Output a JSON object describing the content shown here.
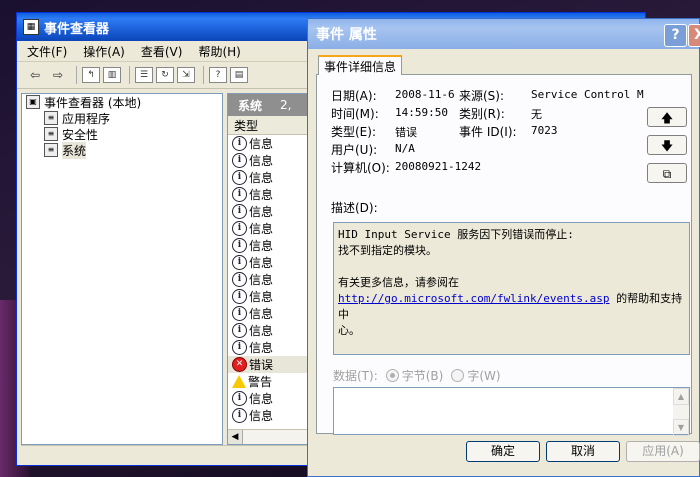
{
  "event_viewer": {
    "title": "事件查看器",
    "menu": [
      "文件(F)",
      "操作(A)",
      "查看(V)",
      "帮助(H)"
    ],
    "tree": [
      {
        "label": "事件查看器 (本地)",
        "icon": "computer-icon"
      },
      {
        "label": "应用程序",
        "icon": "log-icon"
      },
      {
        "label": "安全性",
        "icon": "log-icon"
      },
      {
        "label": "系统",
        "icon": "log-icon"
      }
    ],
    "list_header": "系统",
    "list_count": "2,",
    "column_type": "类型",
    "rows": [
      {
        "type": "信息",
        "level": "info"
      },
      {
        "type": "信息",
        "level": "info"
      },
      {
        "type": "信息",
        "level": "info"
      },
      {
        "type": "信息",
        "level": "info"
      },
      {
        "type": "信息",
        "level": "info"
      },
      {
        "type": "信息",
        "level": "info"
      },
      {
        "type": "信息",
        "level": "info"
      },
      {
        "type": "信息",
        "level": "info"
      },
      {
        "type": "信息",
        "level": "info"
      },
      {
        "type": "信息",
        "level": "info"
      },
      {
        "type": "信息",
        "level": "info"
      },
      {
        "type": "信息",
        "level": "info"
      },
      {
        "type": "信息",
        "level": "info"
      },
      {
        "type": "错误",
        "level": "error"
      },
      {
        "type": "警告",
        "level": "warning"
      },
      {
        "type": "信息",
        "level": "info"
      },
      {
        "type": "信息",
        "level": "info"
      }
    ]
  },
  "properties": {
    "title": "事件 属性",
    "help_glyph": "?",
    "close_glyph": "X",
    "tab": "事件详细信息",
    "date_label": "日期(A):",
    "date_value": "2008-11-6",
    "source_label": "来源(S):",
    "source_value": "Service Control M",
    "time_label": "时间(M):",
    "time_value": "14:59:50",
    "category_label": "类别(R):",
    "category_value": "无",
    "type_label": "类型(E):",
    "type_value": "错误",
    "event_id_label": "事件 ID(I):",
    "event_id_value": "7023",
    "user_label": "用户(U):",
    "user_value": "N/A",
    "computer_label": "计算机(O):",
    "computer_value": "20080921-1242",
    "description_label": "描述(D):",
    "description_line1": "HID Input Service 服务因下列错误而停止:",
    "description_line2": "找不到指定的模块。",
    "description_line3": "有关更多信息，请参阅在",
    "description_link": "http://go.microsoft.com/fwlink/events.asp",
    "description_line4": " 的帮助和支持中",
    "description_line5": "心。",
    "data_label": "数据(T):",
    "bytes_label": "字节(B)",
    "words_label": "字(W)",
    "ok": "确定",
    "cancel": "取消",
    "apply": "应用(A)"
  },
  "icons": {
    "info": "info-icon",
    "error": "error-icon",
    "warning": "warning-icon"
  },
  "colors": {
    "titlebar_active": "#0a5ee0",
    "titlebar_inactive": "#8fb4ec",
    "tab_accent": "#f4a51c",
    "link": "#0000cc"
  }
}
